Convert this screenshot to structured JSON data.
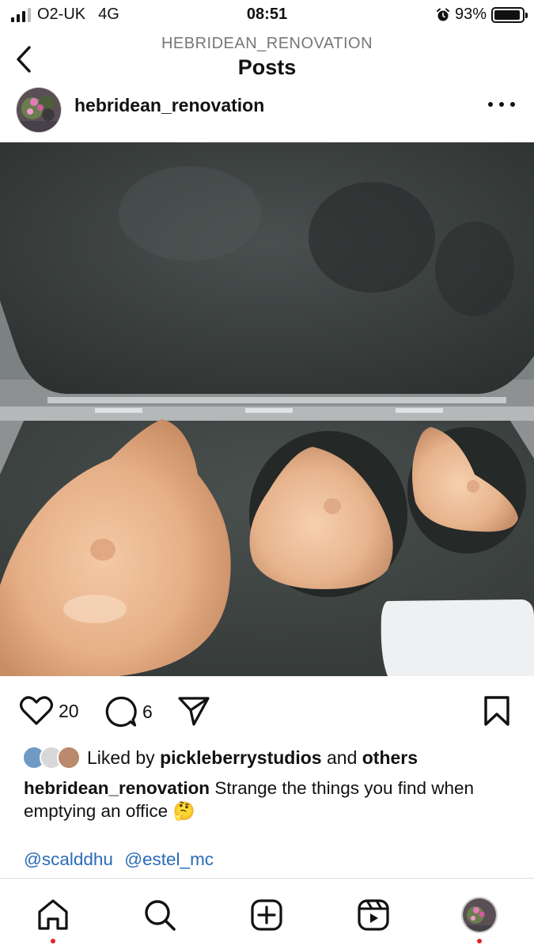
{
  "status": {
    "carrier": "O2-UK",
    "network": "4G",
    "time": "08:51",
    "battery": "93%",
    "battery_level": 0.93
  },
  "header": {
    "account": "HEBRIDEAN_RENOVATION",
    "title": "Posts"
  },
  "post": {
    "username": "hebridean_renovation",
    "likes_count": "20",
    "comments_count": "6",
    "liked_by_prefix": "Liked by",
    "liked_by_user": "pickleberrystudios",
    "liked_by_and": "and",
    "liked_by_others": "others",
    "caption_user": "hebridean_renovation",
    "caption_text": "Strange the things you find when emptying an office 🤔",
    "mentions": [
      "@scalddhu",
      "@estel_mc"
    ]
  },
  "icons": {
    "back": "chevron-left-icon",
    "more": "more-horizontal-icon",
    "like": "heart-icon",
    "comment": "comment-icon",
    "share": "send-icon",
    "save": "bookmark-icon",
    "home": "home-icon",
    "search": "search-icon",
    "create": "plus-square-icon",
    "reels": "reels-icon"
  },
  "colors": {
    "link": "#2a6bb6",
    "notification_dot": "#e02424"
  }
}
